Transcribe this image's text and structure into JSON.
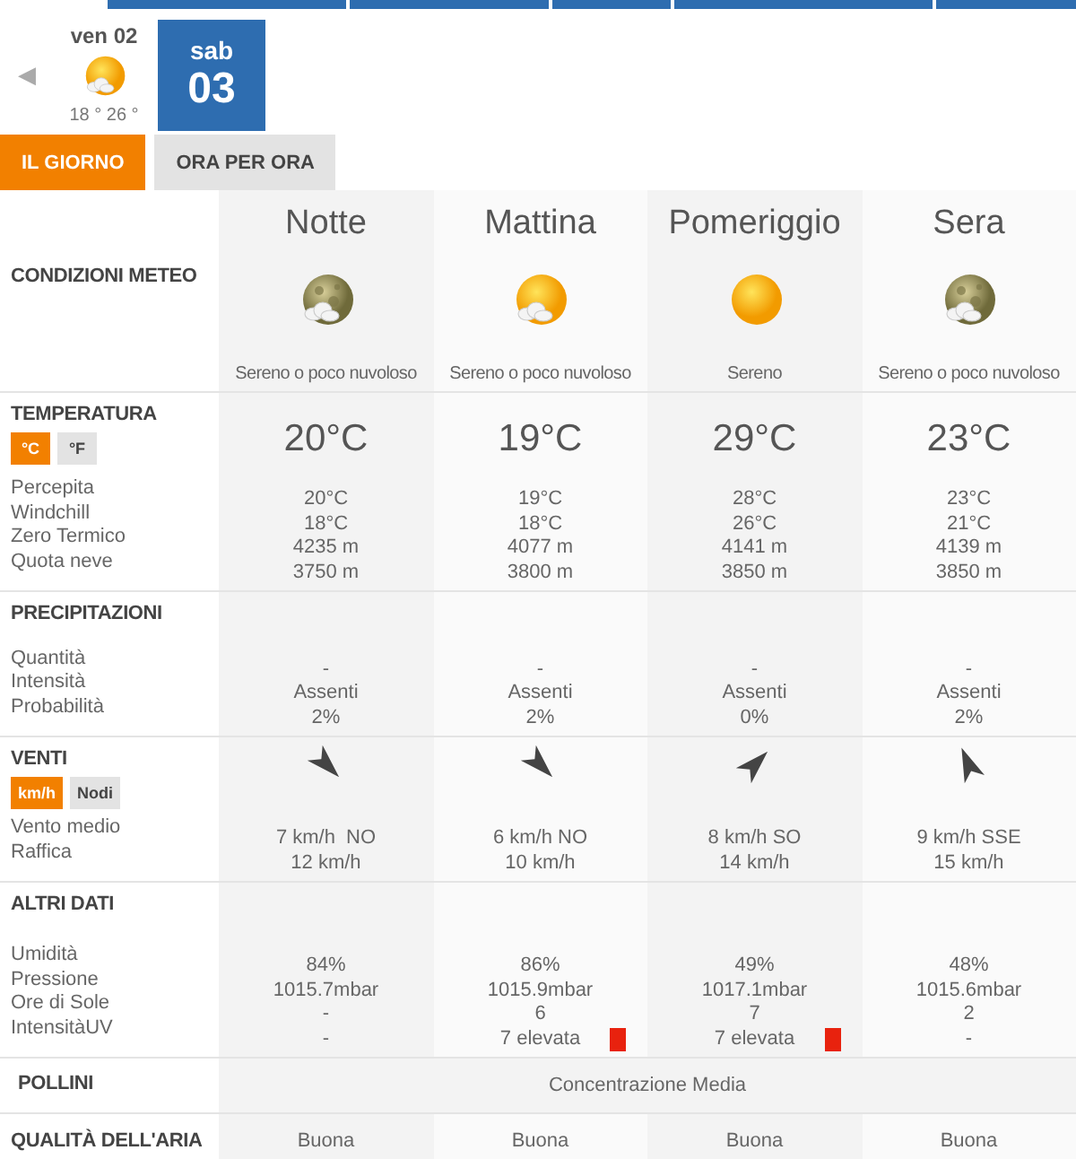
{
  "days": [
    {
      "label": "ven 02",
      "kind": "sun_cloud",
      "temps": "18 ° 26 °",
      "selected": false
    },
    {
      "weekday": "sab",
      "date": "03",
      "selected": true
    }
  ],
  "prev_arrow": "◀",
  "tabs": [
    {
      "label": "IL GIORNO",
      "selected": true
    },
    {
      "label": "ORA PER ORA",
      "selected": false
    }
  ],
  "conditions": {
    "title": "CONDIZIONI METEO",
    "periods": [
      {
        "name": "Notte",
        "kind": "moon_cloud",
        "condition": "Sereno o poco nuvoloso"
      },
      {
        "name": "Mattina",
        "kind": "sun_cloud",
        "condition": "Sereno o poco nuvoloso"
      },
      {
        "name": "Pomeriggio",
        "kind": "sun",
        "condition": "Sereno"
      },
      {
        "name": "Sera",
        "kind": "moon_cloud",
        "condition": "Sereno o poco nuvoloso"
      }
    ]
  },
  "sections": [
    {
      "kind": "main",
      "title": "TEMPERATURA",
      "units": [
        {
          "label": "°C",
          "selected": true
        },
        {
          "label": "°F",
          "selected": false
        }
      ],
      "main": [
        "20°C",
        "19°C",
        "29°C",
        "23°C"
      ],
      "rows": [
        {
          "label": "Percepita",
          "values": [
            "20°C",
            "19°C",
            "28°C",
            "23°C"
          ]
        },
        {
          "label": "Windchill",
          "values": [
            "18°C",
            "18°C",
            "26°C",
            "21°C"
          ]
        },
        {
          "label": "Zero Termico",
          "values": [
            "4235 m",
            "4077 m",
            "4141 m",
            "4139 m"
          ]
        },
        {
          "label": "Quota neve",
          "values": [
            "3750 m",
            "3800 m",
            "3850 m",
            "3850 m"
          ]
        }
      ]
    },
    {
      "kind": "plain",
      "title": "PRECIPITAZIONI",
      "rows": [
        {
          "label": "Quantità",
          "values": [
            "-",
            "-",
            "-",
            "-"
          ]
        },
        {
          "label": "Intensità",
          "values": [
            "Assenti",
            "Assenti",
            "Assenti",
            "Assenti"
          ]
        },
        {
          "label": "Probabilità",
          "values": [
            "2%",
            "2%",
            "0%",
            "2%"
          ]
        }
      ]
    },
    {
      "kind": "wind",
      "title": "VENTI",
      "units": [
        {
          "label": "km/h",
          "selected": true
        },
        {
          "label": "Nodi",
          "selected": false
        }
      ],
      "arrows": [
        {
          "kind": "se"
        },
        {
          "kind": "se"
        },
        {
          "kind": "ne"
        },
        {
          "kind": "nnw"
        }
      ],
      "rows": [
        {
          "label": "Vento medio",
          "values": [
            "7 km/h  NO",
            "6 km/h NO",
            "8 km/h SO",
            "9 km/h SSE"
          ]
        },
        {
          "label": "Raffica",
          "values": [
            "12 km/h",
            "10 km/h",
            "14 km/h",
            "15 km/h"
          ]
        }
      ]
    },
    {
      "kind": "plain",
      "title": "ALTRI DATI",
      "rows": [
        {
          "label": "Umidità",
          "values": [
            "84%",
            "86%",
            "49%",
            "48%"
          ]
        },
        {
          "label": "Pressione",
          "values": [
            "1015.7mbar",
            "1015.9mbar",
            "1017.1mbar",
            "1015.6mbar"
          ]
        },
        {
          "label": "Ore di Sole",
          "values": [
            "-",
            "6",
            "7",
            "2"
          ]
        },
        {
          "label": "IntensitàUV",
          "values": [
            "-",
            "7 elevata",
            "7 elevata",
            "-"
          ],
          "high": [
            false,
            true,
            true,
            false
          ]
        }
      ]
    }
  ],
  "pollini": {
    "title": "POLLINI",
    "value": "Concentrazione Media"
  },
  "air": {
    "title": "QUALITÀ DELL'ARIA",
    "values": [
      "Buona",
      "Buona",
      "Buona",
      "Buona"
    ]
  }
}
